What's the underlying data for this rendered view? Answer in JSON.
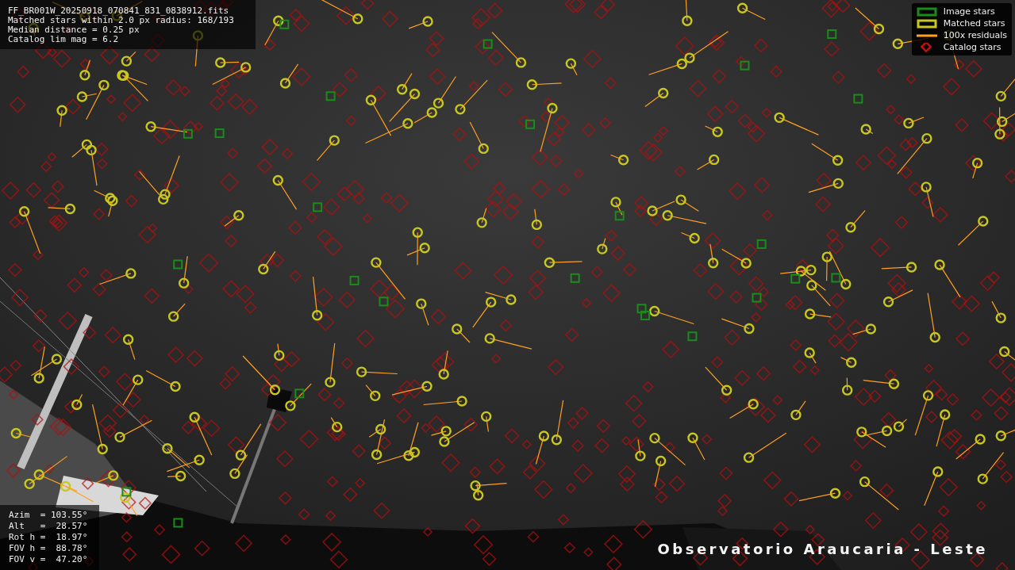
{
  "info_top": [
    "FF_BR001W_20250918_070841_831_0838912.fits",
    "Matched stars within 2.0 px radius: 168/193",
    "Median distance = 0.25 px",
    "Catalog lim mag = 6.2"
  ],
  "legend": [
    {
      "kind": "box",
      "color": "#1a8c1a",
      "label": "Image stars"
    },
    {
      "kind": "box",
      "color": "#c8c820",
      "label": "Matched stars"
    },
    {
      "kind": "line",
      "color": "#ffa020",
      "label": "100x residuals"
    },
    {
      "kind": "diamond",
      "color": "#c01010",
      "label": "Catalog stars"
    }
  ],
  "info_bottom": [
    "Azim  = 103.55°",
    "Alt   =  28.57°",
    "Rot h =  18.97°",
    "FOV h =  88.78°",
    "FOV v =  47.20°"
  ],
  "station_label": "Observatorio Araucaria - Leste"
}
